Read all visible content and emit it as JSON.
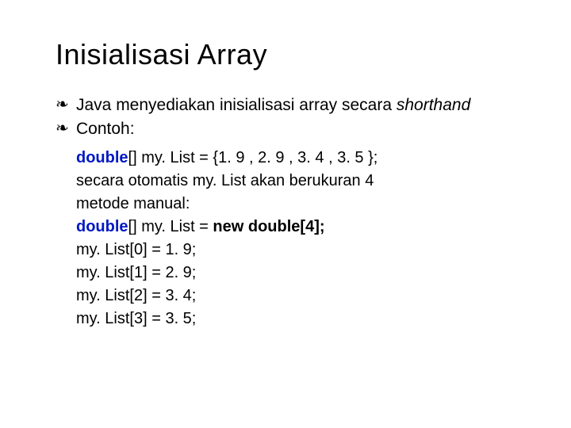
{
  "title": "Inisialisasi Array",
  "bullets": {
    "b1_pre": "Java menyediakan inisialisasi array secara ",
    "b1_em": "shorthand",
    "b2": "Contoh:"
  },
  "code": {
    "l1_kw": "double",
    "l1_rest": "[] my. List = {1. 9 , 2. 9 , 3. 4 , 3. 5 };",
    "l2": "secara otomatis my. List akan berukuran 4",
    "l3": "metode manual:",
    "l4_kw": "double",
    "l4_mid": "[] my. List = ",
    "l4_b": "new double[4];",
    "l5": "my. List[0] = 1. 9;",
    "l6": "my. List[1] = 2. 9;",
    "l7": "my. List[2] = 3. 4;",
    "l8": "my. List[3] = 3. 5;"
  }
}
